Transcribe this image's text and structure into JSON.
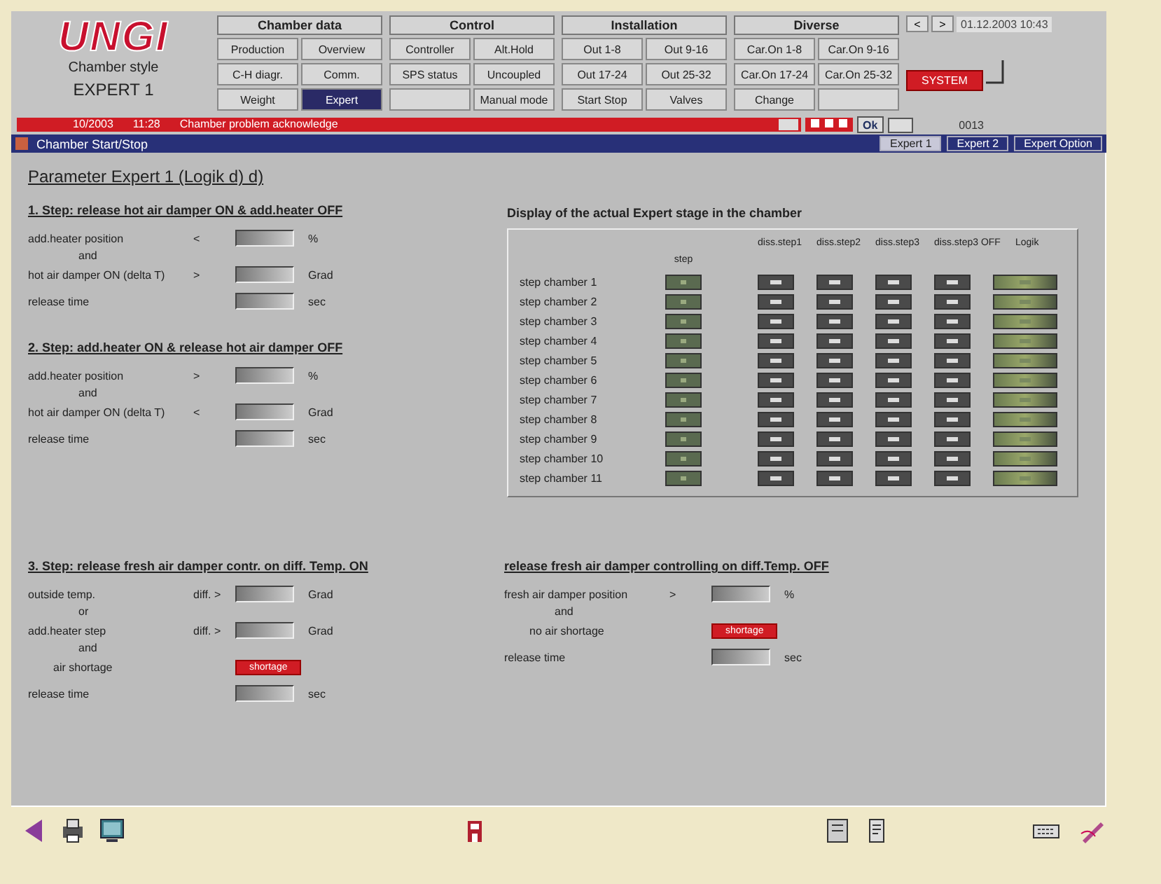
{
  "brand": {
    "logo": "UNGI",
    "subtitle": "Chamber style",
    "mode": "EXPERT 1"
  },
  "menu_groups": [
    {
      "title": "Chamber data",
      "items": [
        {
          "label": "Production",
          "selected": false
        },
        {
          "label": "Overview",
          "selected": false
        },
        {
          "label": "C-H diagr.",
          "selected": false
        },
        {
          "label": "Comm.",
          "selected": false
        },
        {
          "label": "Weight",
          "selected": false
        },
        {
          "label": "Expert",
          "selected": true
        }
      ]
    },
    {
      "title": "Control",
      "items": [
        {
          "label": "Controller",
          "selected": false
        },
        {
          "label": "Alt.Hold",
          "selected": false
        },
        {
          "label": "SPS status",
          "selected": false
        },
        {
          "label": "Uncoupled",
          "selected": false
        },
        {
          "selected": false
        },
        {
          "label": "Manual mode",
          "selected": false
        }
      ]
    },
    {
      "title": "Installation",
      "items": [
        {
          "label": "Out 1-8",
          "selected": false
        },
        {
          "label": "Out 9-16",
          "selected": false
        },
        {
          "label": "Out 17-24",
          "selected": false
        },
        {
          "label": "Out 25-32",
          "selected": false
        },
        {
          "label": "Start Stop",
          "selected": false
        },
        {
          "label": "Valves",
          "selected": false
        }
      ]
    },
    {
      "title": "Diverse",
      "items": [
        {
          "label": "Car.On 1-8",
          "selected": false
        },
        {
          "label": "Car.On 9-16",
          "selected": false
        },
        {
          "label": "Car.On 17-24",
          "selected": false
        },
        {
          "label": "Car.On 25-32",
          "selected": false
        },
        {
          "label": "Change",
          "selected": false
        },
        {
          "selected": false
        }
      ]
    }
  ],
  "top_right": {
    "keys": [
      "<",
      ">"
    ],
    "datetime": "01.12.2003 10:43",
    "alarm_button": "SYSTEM"
  },
  "status_bar": {
    "date": "10/2003",
    "time": "11:28",
    "message": "Chamber problem acknowledge",
    "ok": "Ok",
    "code": "0013"
  },
  "window": {
    "title": "Chamber Start/Stop"
  },
  "tabs": [
    {
      "label": "Expert 1",
      "selected": true
    },
    {
      "label": "Expert 2",
      "selected": false
    },
    {
      "label": "Expert Option",
      "selected": false
    }
  ],
  "heading": "Parameter Expert 1 (Logik d) d)",
  "sections": [
    {
      "title": "1. Step: release hot air damper ON & add.heater OFF",
      "rows": [
        {
          "kind": "field",
          "label": "add.heater position",
          "op": "<",
          "unit": "%"
        },
        {
          "kind": "joiner",
          "label": "and"
        },
        {
          "kind": "field",
          "label": "hot air damper ON (delta T)",
          "op": ">",
          "unit": "Grad"
        },
        {
          "kind": "field",
          "label": "release time",
          "unit": "sec"
        }
      ]
    },
    {
      "title": "2. Step: add.heater ON & release hot air damper OFF",
      "rows": [
        {
          "kind": "field",
          "label": "add.heater position",
          "op": ">",
          "unit": "%"
        },
        {
          "kind": "joiner",
          "label": "and"
        },
        {
          "kind": "field",
          "label": "hot air damper ON (delta T)",
          "op": "<",
          "unit": "Grad"
        },
        {
          "kind": "field",
          "label": "release time",
          "unit": "sec"
        }
      ]
    },
    {
      "title": "3. Step: release fresh air damper contr. on diff. Temp. ON",
      "rows": [
        {
          "kind": "field",
          "label": "outside temp.",
          "op": "diff. >",
          "unit": "Grad"
        },
        {
          "kind": "joiner",
          "label": "or"
        },
        {
          "kind": "field",
          "label": "add.heater step",
          "op": "diff. >",
          "unit": "Grad"
        },
        {
          "kind": "joiner",
          "label": "and"
        },
        {
          "kind": "alarm",
          "label": "air shortage",
          "value": "shortage"
        },
        {
          "kind": "field",
          "label": "release time",
          "unit": "sec"
        }
      ]
    },
    {
      "title": "release fresh air damper controlling on diff.Temp. OFF",
      "rows": [
        {
          "kind": "field",
          "label": "fresh air damper position",
          "op": ">",
          "unit": "%"
        },
        {
          "kind": "joiner",
          "label": "and"
        },
        {
          "kind": "alarm",
          "label": "no air shortage",
          "value": "shortage"
        },
        {
          "kind": "field",
          "label": "release time",
          "unit": "sec"
        }
      ]
    }
  ],
  "stage_table": {
    "title": "Display of the actual Expert stage in the chamber",
    "columns": [
      "step",
      "diss.step1",
      "diss.step2",
      "diss.step3",
      "diss.step3 OFF",
      "Logik"
    ],
    "rows": [
      "step chamber 1",
      "step chamber 2",
      "step chamber 3",
      "step chamber 4",
      "step chamber 5",
      "step chamber 6",
      "step chamber 7",
      "step chamber 8",
      "step chamber 9",
      "step chamber 10",
      "step chamber 11"
    ]
  }
}
